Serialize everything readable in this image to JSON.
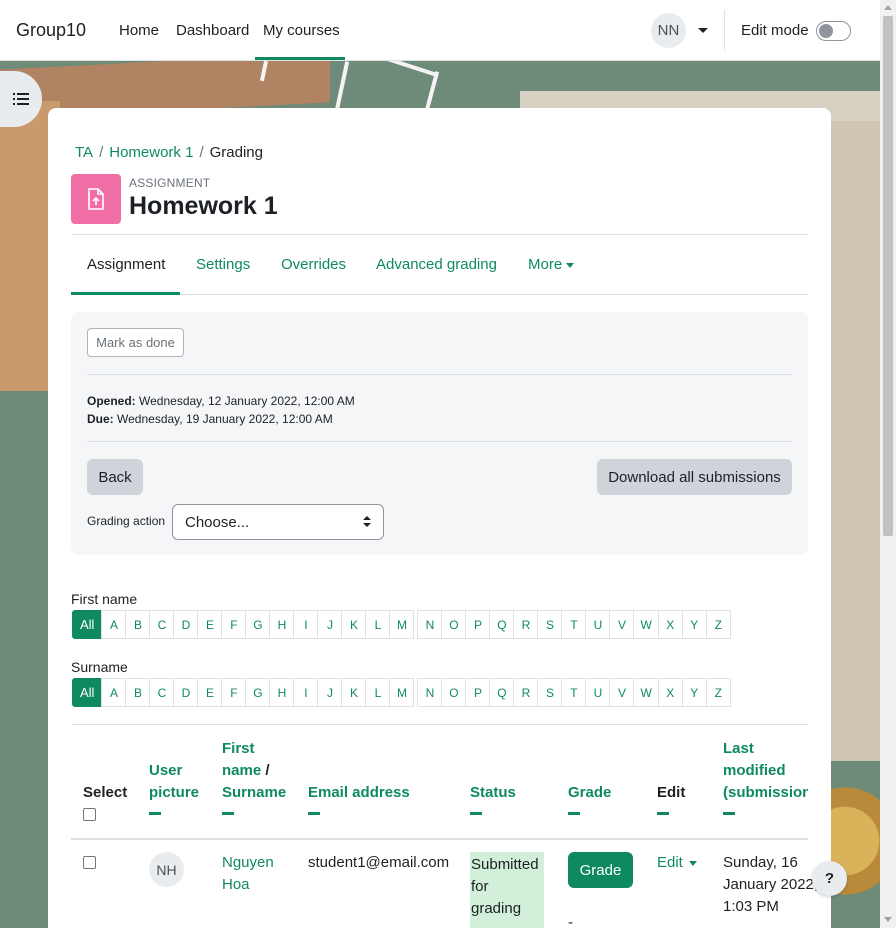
{
  "navbar": {
    "brand": "Group10",
    "links": [
      "Home",
      "Dashboard",
      "My courses"
    ],
    "user_initials": "NN",
    "edit_mode_label": "Edit mode"
  },
  "breadcrumb": [
    "TA",
    "Homework 1",
    "Grading"
  ],
  "header": {
    "module_type": "ASSIGNMENT",
    "title": "Homework 1"
  },
  "tabs": [
    "Assignment",
    "Settings",
    "Overrides",
    "Advanced grading",
    "More"
  ],
  "info": {
    "mark_done": "Mark as done",
    "opened_label": "Opened:",
    "opened_value": "Wednesday, 12 January 2022, 12:00 AM",
    "due_label": "Due:",
    "due_value": "Wednesday, 19 January 2022, 12:00 AM",
    "back": "Back",
    "download_all": "Download all submissions",
    "grading_action_label": "Grading action",
    "grading_action_selected": "Choose..."
  },
  "filters": {
    "first_name_label": "First name",
    "surname_label": "Surname",
    "all": "All",
    "letters": [
      "A",
      "B",
      "C",
      "D",
      "E",
      "F",
      "G",
      "H",
      "I",
      "J",
      "K",
      "L",
      "M",
      "N",
      "O",
      "P",
      "Q",
      "R",
      "S",
      "T",
      "U",
      "V",
      "W",
      "X",
      "Y",
      "Z"
    ]
  },
  "table": {
    "headers": {
      "select": "Select",
      "user_picture_1": "User",
      "user_picture_2": "picture",
      "first_name_1": "First",
      "first_name_2": "name",
      "first_name_sep": " /",
      "surname": "Surname",
      "email": "Email address",
      "status": "Status",
      "grade": "Grade",
      "edit": "Edit",
      "last_modified_1": "Last",
      "last_modified_2": "modified",
      "last_modified_3": "(submission)"
    },
    "rows": [
      {
        "initials": "NH",
        "first": "Nguyen",
        "last": "Hoa",
        "email": "student1@email.com",
        "status_1": "Submitted",
        "status_2": "for",
        "status_3": "grading",
        "grade_button": "Grade",
        "grade_value": "-",
        "edit": "Edit",
        "modified_1": "Sunday, 16",
        "modified_2": "January 2022,",
        "modified_3": "1:03 PM"
      }
    ]
  },
  "help": "?"
}
